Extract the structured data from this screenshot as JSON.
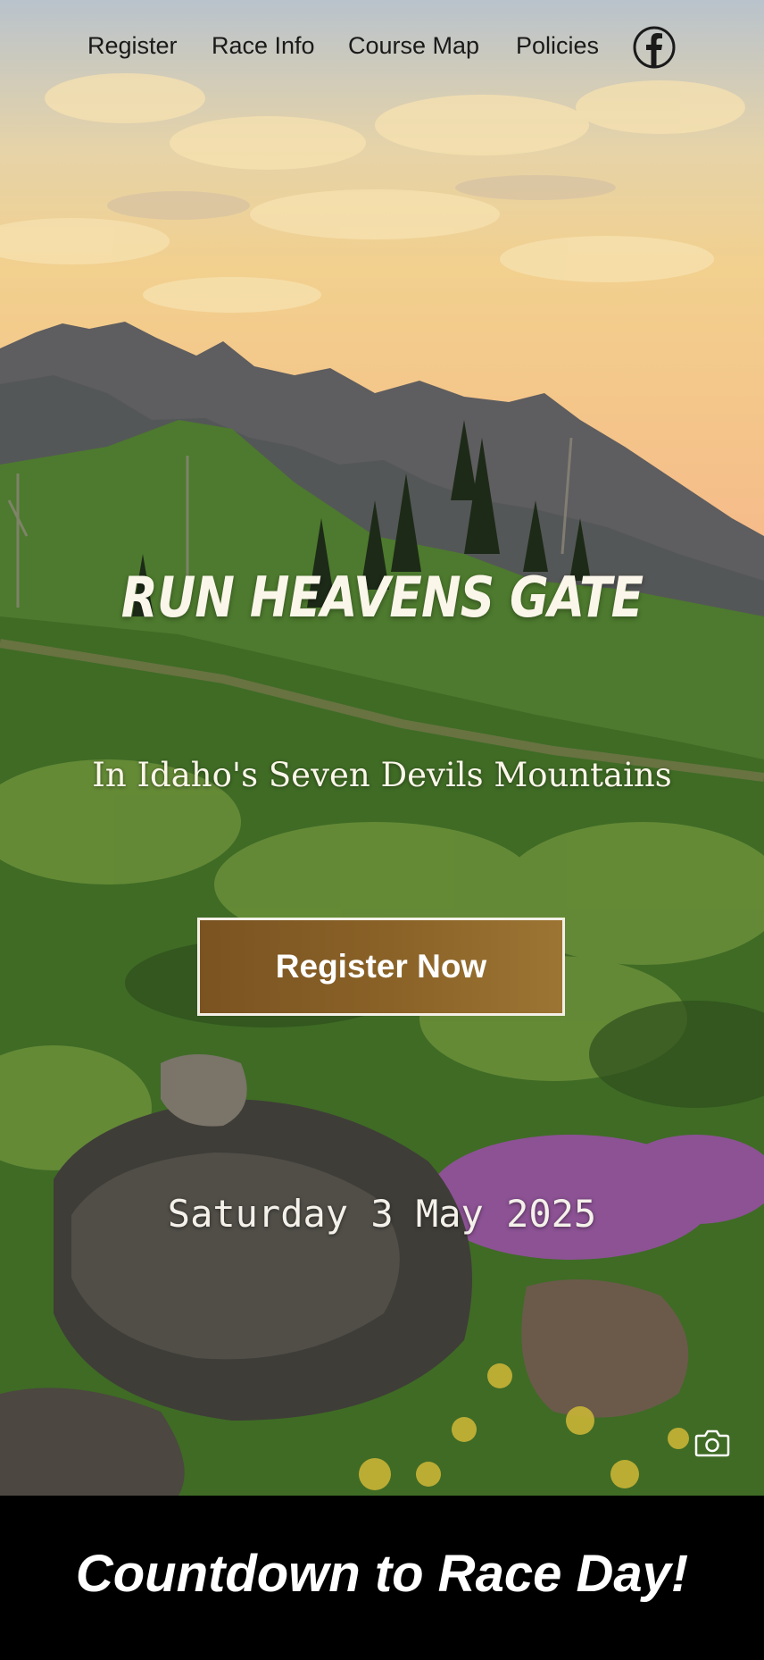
{
  "nav": {
    "items": [
      {
        "label": "Register"
      },
      {
        "label": "Race Info"
      },
      {
        "label": "Course Map"
      },
      {
        "label": "Policies"
      }
    ],
    "social_icon": "facebook-icon"
  },
  "hero": {
    "title": "RUN HEAVENS GATE",
    "subtitle": "In Idaho's Seven Devils Mountains",
    "cta_label": "Register Now",
    "date": "Saturday 3 May 2025",
    "photo_credit_icon": "camera-icon"
  },
  "countdown": {
    "heading": "Countdown to Race Day!"
  },
  "colors": {
    "cta_background": "#8b6328",
    "cta_border": "#f3efe6",
    "band_background": "#000000",
    "hero_text": "#fbf6ea"
  }
}
